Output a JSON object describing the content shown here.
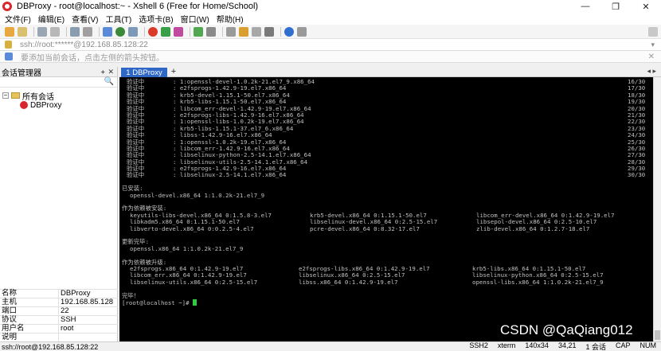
{
  "window": {
    "title": "DBProxy - root@localhost:~ - Xshell 6 (Free for Home/School)",
    "min_glyph": "—",
    "max_glyph": "❐",
    "close_glyph": "✕"
  },
  "menu": [
    "文件(F)",
    "编辑(E)",
    "查看(V)",
    "工具(T)",
    "选项卡(B)",
    "窗口(W)",
    "帮助(H)"
  ],
  "address": {
    "text": "ssh://root:******@192.168.85.128:22",
    "caret": "▾"
  },
  "hint": {
    "text": "要添加当前会话，点击左侧的箭头按钮。",
    "close": "✕"
  },
  "sidebar": {
    "title": "会话管理器",
    "pin": "ᚐ",
    "close": "✕",
    "search_glyph": "🔍",
    "tree": {
      "root_twisty": "−",
      "root_label": "所有会话",
      "child_label": "DBProxy"
    },
    "properties": [
      {
        "key": "名称",
        "value": "DBProxy"
      },
      {
        "key": "主机",
        "value": "192.168.85.128"
      },
      {
        "key": "端口",
        "value": "22"
      },
      {
        "key": "协议",
        "value": "SSH"
      },
      {
        "key": "用户名",
        "value": "root"
      },
      {
        "key": "说明",
        "value": ""
      }
    ]
  },
  "tabs": {
    "active_label": "1 DBProxy",
    "add": "+",
    "nav": "◂ ▸"
  },
  "terminal": {
    "verify_rows": [
      [
        "验证中",
        ": 1:openssl-devel-1.0.2k-21.el7_9.x86_64",
        "16/30"
      ],
      [
        "验证中",
        ": e2fsprogs-1.42.9-19.el7.x86_64",
        "17/30"
      ],
      [
        "验证中",
        ": krb5-devel-1.15.1-50.el7.x86_64",
        "18/30"
      ],
      [
        "验证中",
        ": krb5-libs-1.15.1-50.el7.x86_64",
        "19/30"
      ],
      [
        "验证中",
        ": libcom_err-devel-1.42.9-19.el7.x86_64",
        "20/30"
      ],
      [
        "验证中",
        ": e2fsprogs-libs-1.42.9-16.el7.x86_64",
        "21/30"
      ],
      [
        "验证中",
        ": 1:openssl-libs-1.0.2k-19.el7.x86_64",
        "22/30"
      ],
      [
        "验证中",
        ": krb5-libs-1.15.1-37.el7_6.x86_64",
        "23/30"
      ],
      [
        "验证中",
        ": libss-1.42.9-16.el7.x86_64",
        "24/30"
      ],
      [
        "验证中",
        ": 1:openssl-1.0.2k-19.el7.x86_64",
        "25/30"
      ],
      [
        "验证中",
        ": libcom_err-1.42.9-16.el7.x86_64",
        "26/30"
      ],
      [
        "验证中",
        ": libselinux-python-2.5-14.1.el7.x86_64",
        "27/30"
      ],
      [
        "验证中",
        ": libselinux-utils-2.5-14.1.el7.x86_64",
        "28/30"
      ],
      [
        "验证中",
        ": e2fsprogs-1.42.9-16.el7.x86_64",
        "29/30"
      ],
      [
        "验证中",
        ": libselinux-2.5-14.1.el7.x86_64",
        "30/30"
      ]
    ],
    "installed_header": "已安装:",
    "installed_pkg": "openssl-devel.x86_64 1:1.0.2k-21.el7_9",
    "dep_installed_header": "作为依赖被安装:",
    "dep_installed": [
      [
        "keyutils-libs-devel.x86_64 0:1.5.8-3.el7",
        "krb5-devel.x86_64 0:1.15.1-50.el7",
        "libcom_err-devel.x86_64 0:1.42.9-19.el7"
      ],
      [
        "libkadm5.x86_64 0:1.15.1-50.el7",
        "libselinux-devel.x86_64 0:2.5-15.el7",
        "libsepol-devel.x86_64 0:2.5-10.el7"
      ],
      [
        "libverto-devel.x86_64 0:0.2.5-4.el7",
        "pcre-devel.x86_64 0:8.32-17.el7",
        "zlib-devel.x86_64 0:1.2.7-18.el7"
      ]
    ],
    "updated_header": "更新完毕:",
    "updated_pkg": "openssl.x86_64 1:1.0.2k-21.el7_9",
    "dep_updated_header": "作为依赖被升级:",
    "dep_updated": [
      [
        "e2fsprogs.x86_64 0:1.42.9-19.el7",
        "e2fsprogs-libs.x86_64 0:1.42.9-19.el7",
        "krb5-libs.x86_64 0:1.15.1-50.el7"
      ],
      [
        "libcom_err.x86_64 0:1.42.9-19.el7",
        "libselinux.x86_64 0:2.5-15.el7",
        "libselinux-python.x86_64 0:2.5-15.el7"
      ],
      [
        "libselinux-utils.x86_64 0:2.5-15.el7",
        "libss.x86_64 0:1.42.9-19.el7",
        "openssl-libs.x86_64 1:1.0.2k-21.el7_9"
      ]
    ],
    "complete": "完毕！",
    "prompt": "[root@localhost ~]# "
  },
  "watermark": "CSDN @QaQiang012",
  "status": {
    "left": "ssh://root@192.168.85.128:22",
    "protocol": "SSH2",
    "term": "xterm",
    "size": "140x34",
    "cursor": "34,21",
    "sessions": "1 会话",
    "caps": "CAP",
    "num": "NUM"
  }
}
